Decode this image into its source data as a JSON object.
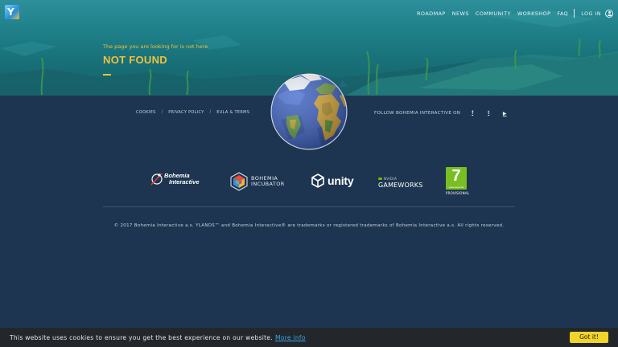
{
  "header": {
    "logo_icon": "ylands-logo-icon",
    "nav": [
      "ROADMAP",
      "NEWS",
      "COMMUNITY",
      "WORKSHOP",
      "FAQ"
    ],
    "login_label": "LOG IN",
    "user_icon": "user-icon"
  },
  "hero": {
    "subtitle": "The page you are looking for is not here",
    "title": "NOT FOUND"
  },
  "footer": {
    "links": [
      "COOKIES",
      "PRIVACY POLICY",
      "EULA & TERMS"
    ],
    "follow_label": "FOLLOW BOHEMIA INTERACTIVE ON",
    "social": [
      {
        "icon": "facebook-icon",
        "glyph": "f"
      },
      {
        "icon": "twitter-icon",
        "glyph": "t"
      },
      {
        "icon": "youtube-icon",
        "glyph": "▶"
      }
    ],
    "partners": {
      "bohemia_line1": "Bohemia",
      "bohemia_line2": "Interactive",
      "incubator_line1": "BOHEMIA",
      "incubator_line2": "INCUBATOR",
      "unity": "unity",
      "nvidia_top": "NVIDIA",
      "nvidia_bottom": "GAMEWORKS",
      "pegi_rating": "7",
      "pegi_url": "www.pegi.info",
      "pegi_note": "PROVISIONAL"
    },
    "copyright": "© 2017 Bohemia Interactive a.s. YLANDS™ and Bohemia Interactive® are trademarks or registered trademarks of Bohemia Interactive a.s. All rights reserved."
  },
  "cookie": {
    "message": "This website uses cookies to ensure you get the best experience on our website.",
    "more_info": "More info",
    "button": "Got it!"
  },
  "colors": {
    "accent": "#f0c23b",
    "footer_bg": "#1d3550",
    "cookie_button": "#f1d32a",
    "link": "#3aa7e8"
  }
}
